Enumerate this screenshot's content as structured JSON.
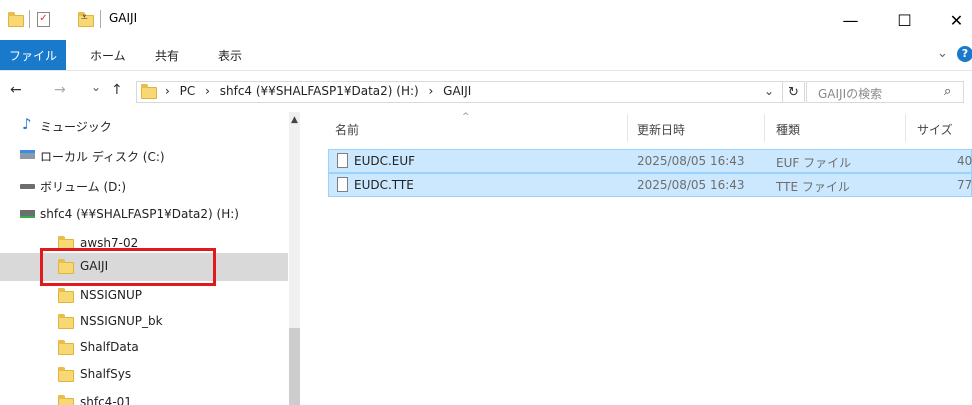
{
  "window": {
    "title": "GAIJI",
    "minimize_glyph": "—",
    "maximize_glyph": "☐",
    "close_glyph": "✕"
  },
  "ribbon": {
    "tabs": [
      "ファイル",
      "ホーム",
      "共有",
      "表示"
    ],
    "collapse_glyph": "⌄",
    "help_glyph": "?"
  },
  "nav_buttons": {
    "back": "←",
    "forward": "→",
    "recent": "⌄",
    "up": "↑"
  },
  "address": {
    "crumbs": [
      "PC",
      "shfc4 (¥¥SHALFASP1¥Data2) (H:)",
      "GAIJI"
    ],
    "separator": "›",
    "dropdown_glyph": "⌄",
    "refresh_glyph": "↻"
  },
  "search": {
    "placeholder": "GAIJIの検索",
    "icon": "⌕"
  },
  "nav_pane": {
    "items": [
      {
        "label": "ミュージック",
        "icon": "music-icon"
      },
      {
        "label": "ローカル ディスク (C:)",
        "icon": "local-disk-icon"
      },
      {
        "label": "ボリューム (D:)",
        "icon": "drive-icon"
      },
      {
        "label": "shfc4 (¥¥SHALFASP1¥Data2) (H:)",
        "icon": "network-drive-icon"
      },
      {
        "label": "awsh7-02",
        "icon": "folder-icon"
      },
      {
        "label": "GAIJI",
        "icon": "folder-icon",
        "selected": true
      },
      {
        "label": "NSSIGNUP",
        "icon": "folder-icon"
      },
      {
        "label": "NSSIGNUP_bk",
        "icon": "folder-icon"
      },
      {
        "label": "ShalfData",
        "icon": "folder-icon"
      },
      {
        "label": "ShalfSys",
        "icon": "folder-icon"
      },
      {
        "label": "shfc4-01",
        "icon": "folder-icon"
      }
    ],
    "scroll_up_glyph": "▲"
  },
  "file_list": {
    "columns": {
      "name": "名前",
      "modified": "更新日時",
      "type": "種類",
      "size": "サイズ"
    },
    "sort_glyph": "^",
    "rows": [
      {
        "name": "EUDC.EUF",
        "modified": "2025/08/05 16:43",
        "type": "EUF ファイル",
        "size": "40"
      },
      {
        "name": "EUDC.TTE",
        "modified": "2025/08/05 16:43",
        "type": "TTE ファイル",
        "size": "77"
      }
    ]
  },
  "colors": {
    "accent": "#1979ca",
    "selection": "#cce8ff",
    "selection_border": "#99d1ff",
    "nav_selected": "#d9d9d9",
    "highlight_red": "#e0191b",
    "folder": "#f8d775"
  }
}
